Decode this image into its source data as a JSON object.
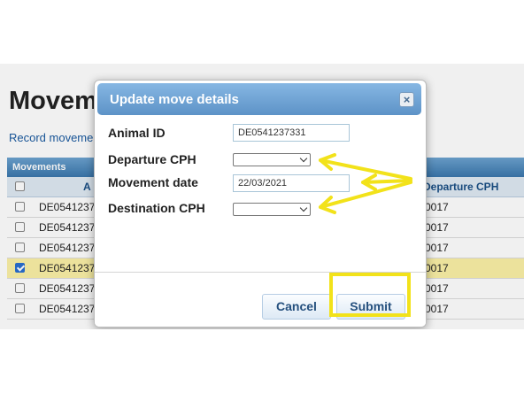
{
  "background_page": {
    "title": "Moveme",
    "link": "Record moveme",
    "grid_title": "Movements",
    "columns": {
      "animal_partial": "A",
      "departure": "Departure CPH"
    },
    "rows": [
      {
        "animal": "DE0541237",
        "departure": "0017",
        "checked": false,
        "selected": false
      },
      {
        "animal": "DE0541237",
        "departure": "0017",
        "checked": false,
        "selected": false
      },
      {
        "animal": "DE0541237",
        "departure": "0017",
        "checked": false,
        "selected": false
      },
      {
        "animal": "DE0541237",
        "departure": "0017",
        "checked": true,
        "selected": true
      },
      {
        "animal": "DE0541237",
        "departure": "0017",
        "checked": false,
        "selected": false
      },
      {
        "animal": "DE0541237",
        "departure": "0017",
        "checked": false,
        "selected": false
      }
    ]
  },
  "dialog": {
    "title": "Update move details",
    "close_icon": "close-icon",
    "fields": {
      "animal_id": {
        "label": "Animal ID",
        "value": "DE0541237331"
      },
      "departure_cph": {
        "label": "Departure CPH",
        "value": ""
      },
      "movement_date": {
        "label": "Movement date",
        "value": "22/03/2021"
      },
      "destination_cph": {
        "label": "Destination CPH",
        "value": ""
      }
    },
    "buttons": {
      "cancel": "Cancel",
      "submit": "Submit"
    }
  },
  "annotation": {
    "color": "#f2e21a"
  },
  "colors": {
    "header_blue": "#5d93c7",
    "selected_row": "#fbf1a6",
    "button_text": "#25507e"
  }
}
